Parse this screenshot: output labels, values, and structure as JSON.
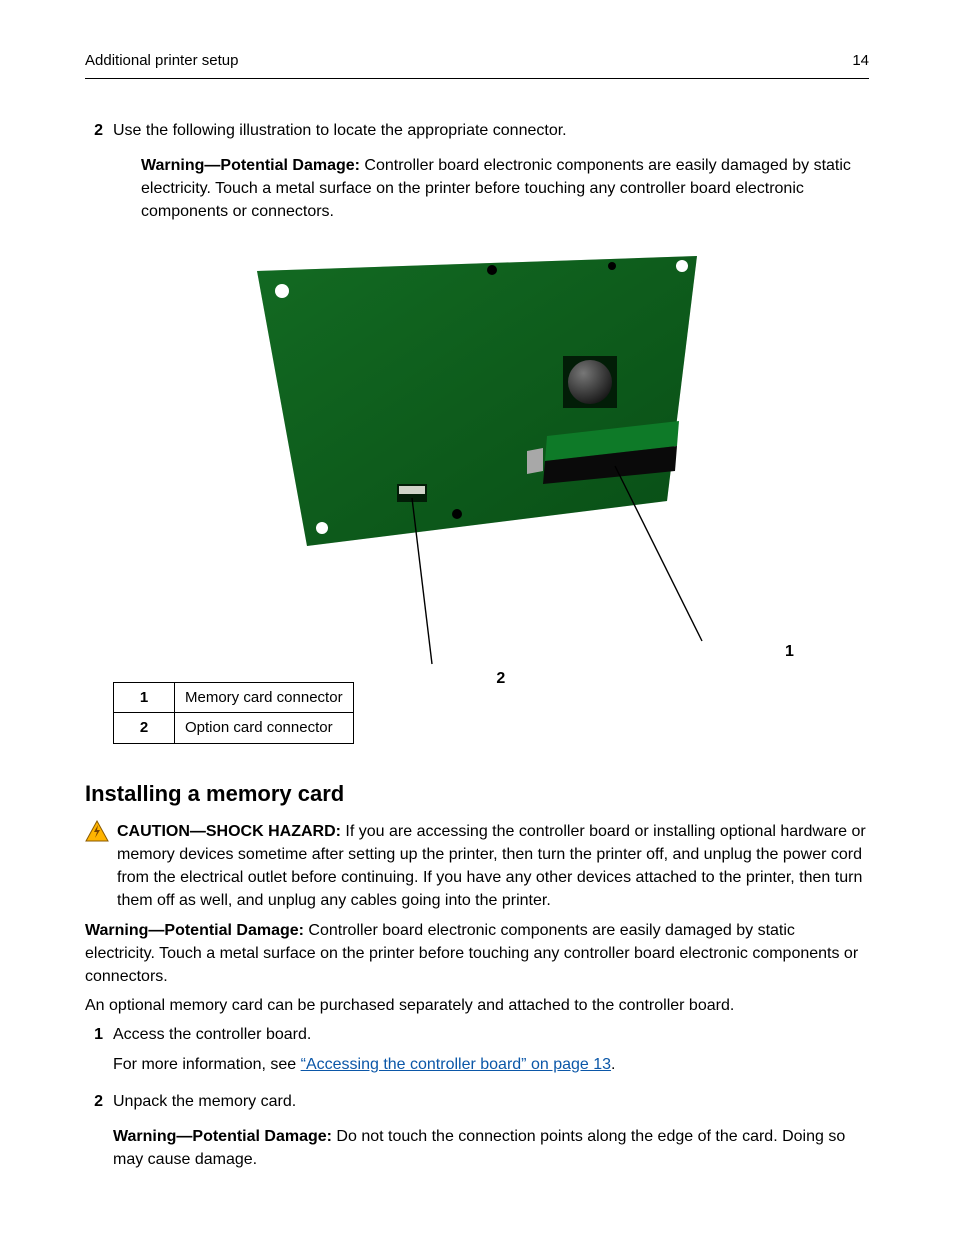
{
  "header": {
    "section_title": "Additional printer setup",
    "page_number": "14"
  },
  "step2": {
    "num": "2",
    "text": "Use the following illustration to locate the appropriate connector.",
    "warning_label": "Warning—Potential Damage:",
    "warning_text": " Controller board electronic components are easily damaged by static electricity. Touch a metal surface on the printer before touching any controller board electronic components or connectors."
  },
  "callouts": {
    "c1": "1",
    "c2": "2"
  },
  "legend": {
    "r1n": "1",
    "r1t": "Memory card connector",
    "r2n": "2",
    "r2t": "Option card connector"
  },
  "install": {
    "heading": "Installing a memory card",
    "caution_label": "CAUTION—SHOCK HAZARD:",
    "caution_text": " If you are accessing the controller board or installing optional hardware or memory devices sometime after setting up the printer, then turn the printer off, and unplug the power cord from the electrical outlet before continuing. If you have any other devices attached to the printer, then turn them off as well, and unplug any cables going into the printer.",
    "warn2_label": "Warning—Potential Damage:",
    "warn2_text": " Controller board electronic components are easily damaged by static electricity. Touch a metal surface on the printer before touching any controller board electronic components or connectors.",
    "para_optional": "An optional memory card can be purchased separately and attached to the controller board.",
    "s1n": "1",
    "s1t": "Access the controller board.",
    "s1_more_pre": "For more information, see ",
    "s1_link": "“Accessing the controller board” on page 13",
    "s1_more_post": ".",
    "s2n": "2",
    "s2t": "Unpack the memory card.",
    "s2_warn_label": "Warning—Potential Damage:",
    "s2_warn_text": " Do not touch the connection points along the edge of the card. Doing so may cause damage."
  }
}
